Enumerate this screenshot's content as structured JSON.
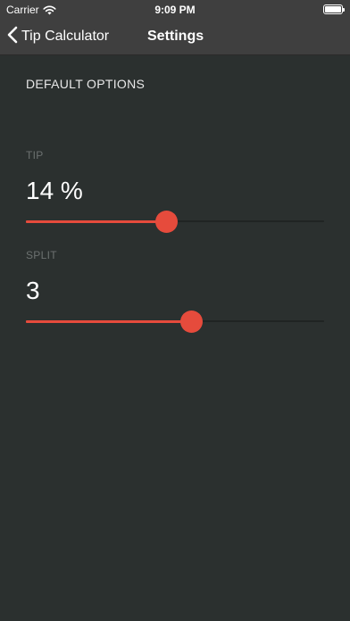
{
  "status_bar": {
    "carrier": "Carrier",
    "time": "9:09 PM",
    "wifi_icon": "wifi-icon",
    "battery_icon": "battery-icon",
    "battery_level": 1.0
  },
  "nav": {
    "back_label": "Tip Calculator",
    "back_icon": "chevron-left-icon",
    "title": "Settings"
  },
  "section_header": "DEFAULT OPTIONS",
  "tip": {
    "label": "TIP",
    "value": "14 %",
    "slider_fraction": 0.47
  },
  "split": {
    "label": "SPLIT",
    "value": "3",
    "slider_fraction": 0.555
  },
  "colors": {
    "background": "#2b302f",
    "bar": "#3f3f3f",
    "accent": "#e64b3c",
    "track": "#202423",
    "muted_label": "#6c7170"
  }
}
